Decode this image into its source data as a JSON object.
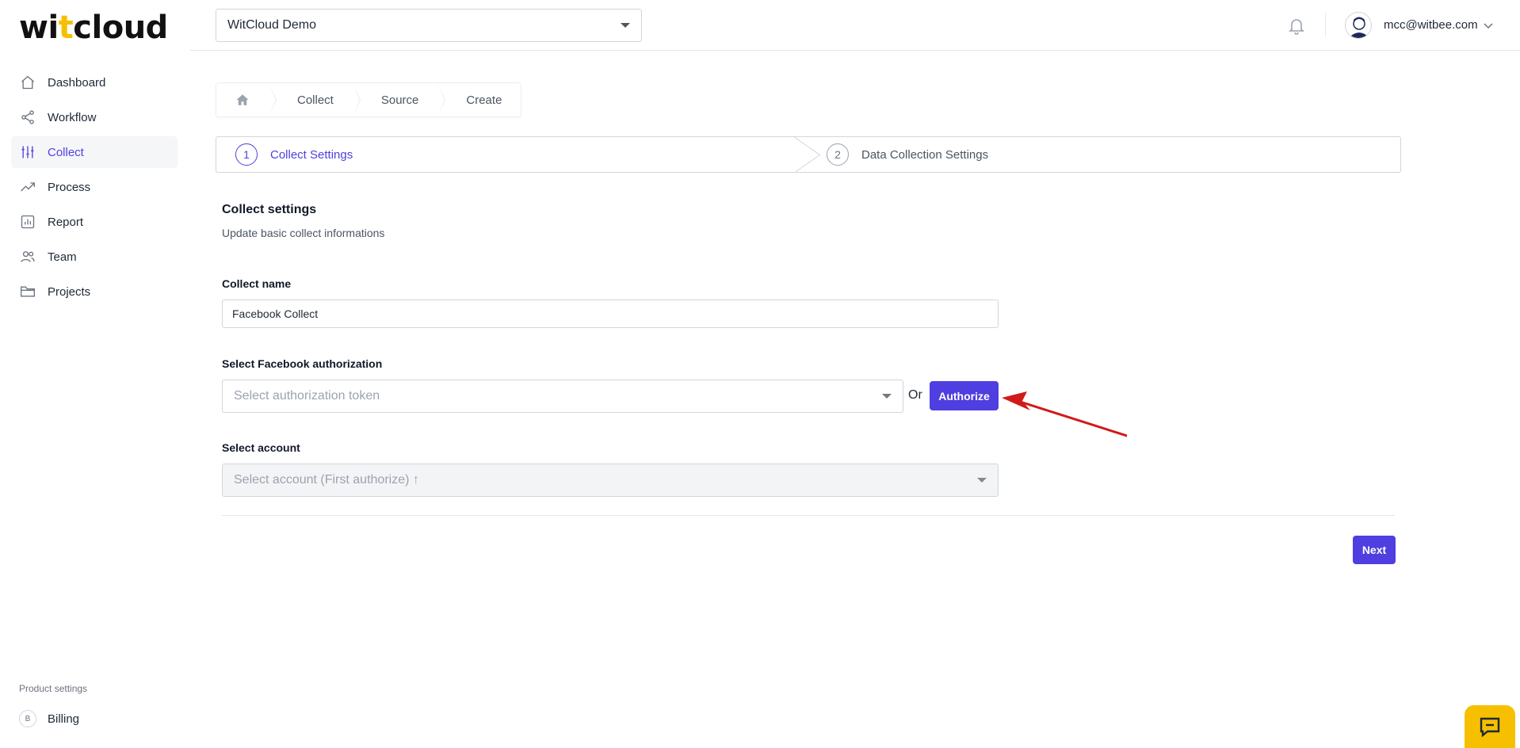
{
  "brand": {
    "logo_pre": "wi",
    "logo_acc": "t",
    "logo_post": "cloud",
    "accent": "#4f3fe0",
    "logo_accent": "#f6c000"
  },
  "header": {
    "org_select_value": "WitCloud Demo",
    "user_email": "mcc@witbee.com"
  },
  "sidebar": {
    "items": [
      {
        "label": "Dashboard",
        "icon": "home-icon"
      },
      {
        "label": "Workflow",
        "icon": "share-icon"
      },
      {
        "label": "Collect",
        "icon": "sliders-icon",
        "active": true
      },
      {
        "label": "Process",
        "icon": "trending-icon"
      },
      {
        "label": "Report",
        "icon": "bar-chart-icon"
      },
      {
        "label": "Team",
        "icon": "users-icon"
      },
      {
        "label": "Projects",
        "icon": "folder-icon"
      }
    ],
    "product_settings_label": "Product settings",
    "billing_badge": "B",
    "billing_label": "Billing"
  },
  "breadcrumb": [
    "Collect",
    "Source",
    "Create"
  ],
  "stepper": {
    "step1_num": "1",
    "step1_label": "Collect Settings",
    "step2_num": "2",
    "step2_label": "Data Collection Settings"
  },
  "form": {
    "title": "Collect settings",
    "subtitle": "Update basic collect informations",
    "name_label": "Collect name",
    "name_value": "Facebook Collect",
    "auth_label": "Select Facebook authorization",
    "auth_placeholder": "Select authorization token",
    "or_text": "Or",
    "authorize_button": "Authorize",
    "account_label": "Select account",
    "account_placeholder": "Select account (First authorize) ↑",
    "next_button": "Next"
  }
}
